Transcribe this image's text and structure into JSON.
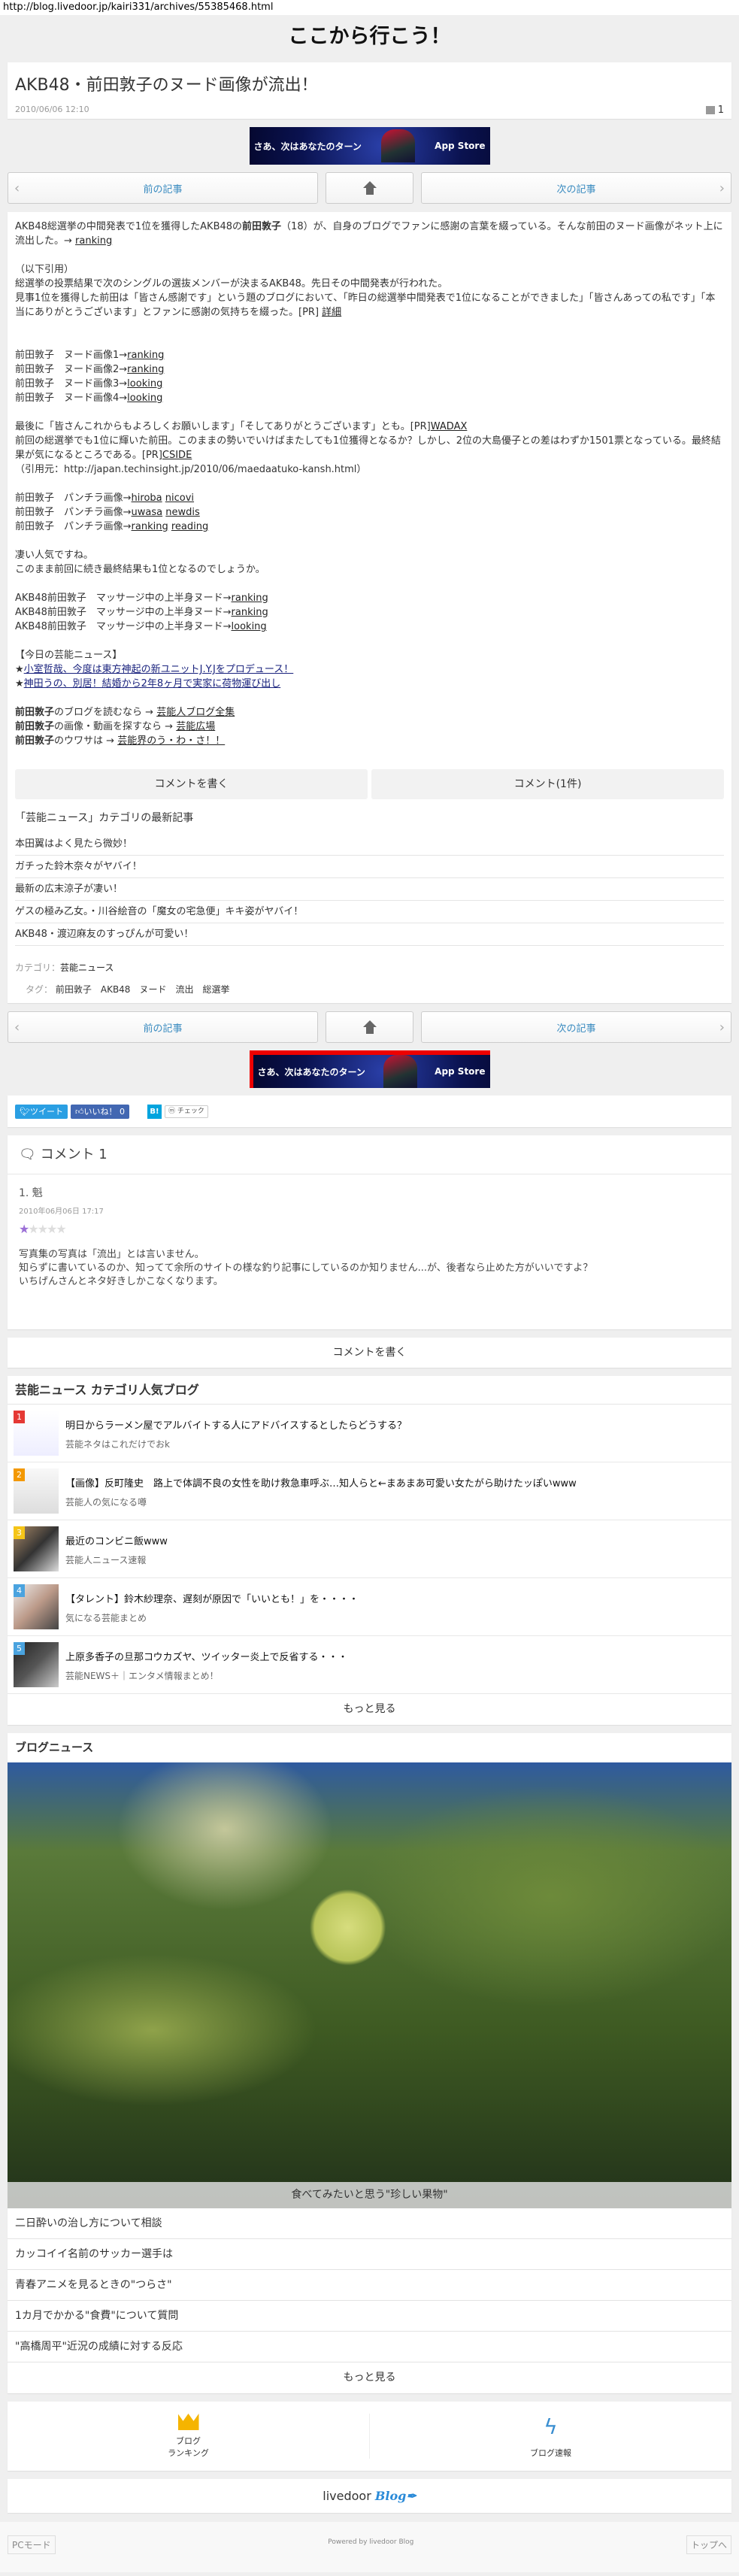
{
  "url": "http://blog.livedoor.jp/kairi331/archives/55385468.html",
  "site_title": "ここから行こう！",
  "article": {
    "title": "AKB48・前田敦子のヌード画像が流出！",
    "date": "2010/06/06 12:10",
    "comment_count": "1",
    "body": [
      [
        {
          "text": "AKB48総選挙の中間発表で1位を獲得したAKB48の"
        },
        {
          "text": "前田敦子",
          "style": "bold"
        },
        {
          "text": "（18）が、自身のブログでファンに感謝の言葉を綴っている。そんな前田のヌード画像がネット上に流出した。→ "
        },
        {
          "text": "ranking",
          "style": "link"
        }
      ],
      [],
      [
        {
          "text": "（以下引用）"
        }
      ],
      [
        {
          "text": "総選挙の投票結果で次のシングルの選抜メンバーが決まるAKB48。先日その中間発表が行われた。"
        }
      ],
      [
        {
          "text": "見事1位を獲得した前田は「皆さん感謝です」という題のブログにおいて、「昨日の総選挙中間発表で1位になることができました」「皆さんあっての私です」「本当にありがとうございます」とファンに感謝の気持ちを綴った。[PR] "
        },
        {
          "text": "詳細",
          "style": "link"
        }
      ],
      [],
      [],
      [
        {
          "text": "前田敦子　ヌード画像1→"
        },
        {
          "text": "ranking",
          "style": "link"
        }
      ],
      [
        {
          "text": "前田敦子　ヌード画像2→"
        },
        {
          "text": "ranking",
          "style": "link"
        }
      ],
      [
        {
          "text": "前田敦子　ヌード画像3→"
        },
        {
          "text": "looking",
          "style": "link"
        }
      ],
      [
        {
          "text": "前田敦子　ヌード画像4→"
        },
        {
          "text": "looking",
          "style": "link"
        }
      ],
      [],
      [
        {
          "text": "最後に「皆さんこれからもよろしくお願いします」「そしてありがとうございます」とも。[PR]"
        },
        {
          "text": "WADAX",
          "style": "link"
        }
      ],
      [
        {
          "text": "前回の総選挙でも1位に輝いた前田。このままの勢いでいけばまたしても1位獲得となるか？しかし、2位の大島優子との差はわずか1501票となっている。最終結果が気になるところである。[PR]"
        },
        {
          "text": "CSIDE",
          "style": "link"
        }
      ],
      [
        {
          "text": "（引用元：http://japan.techinsight.jp/2010/06/maedaatuko-kansh.html）"
        }
      ],
      [],
      [
        {
          "text": "前田敦子　パンチラ画像→"
        },
        {
          "text": "hiroba",
          "style": "link"
        },
        {
          "text": " "
        },
        {
          "text": "nicovi",
          "style": "link"
        }
      ],
      [
        {
          "text": "前田敦子　パンチラ画像→"
        },
        {
          "text": "uwasa",
          "style": "link"
        },
        {
          "text": " "
        },
        {
          "text": "newdis",
          "style": "link"
        }
      ],
      [
        {
          "text": "前田敦子　パンチラ画像→"
        },
        {
          "text": "ranking",
          "style": "link"
        },
        {
          "text": " "
        },
        {
          "text": "reading",
          "style": "link"
        }
      ],
      [],
      [
        {
          "text": "凄い人気ですね。"
        }
      ],
      [
        {
          "text": "このまま前回に続き最終結果も1位となるのでしょうか。"
        }
      ],
      [],
      [
        {
          "text": "AKB48前田敦子　マッサージ中の上半身ヌード→"
        },
        {
          "text": "ranking",
          "style": "link"
        }
      ],
      [
        {
          "text": "AKB48前田敦子　マッサージ中の上半身ヌード→"
        },
        {
          "text": "ranking",
          "style": "link"
        }
      ],
      [
        {
          "text": "AKB48前田敦子　マッサージ中の上半身ヌード→"
        },
        {
          "text": "looking",
          "style": "link"
        }
      ],
      [],
      [
        {
          "text": "【今日の芸能ニュース】"
        }
      ],
      [
        {
          "text": "★"
        },
        {
          "text": "小室哲哉、今度は東方神起の新ユニットJ.Y.Jをプロデュース！",
          "style": "news-link"
        }
      ],
      [
        {
          "text": "★"
        },
        {
          "text": "神田うの、別居！結婚から2年8ヶ月で実家に荷物運び出し",
          "style": "news-link"
        }
      ],
      [],
      [
        {
          "text": "前田敦子",
          "style": "bold"
        },
        {
          "text": "のブログを読むなら → "
        },
        {
          "text": "芸能人ブログ全集",
          "style": "link"
        }
      ],
      [
        {
          "text": "前田敦子",
          "style": "bold"
        },
        {
          "text": "の画像・動画を探すなら → "
        },
        {
          "text": "芸能広場",
          "style": "link"
        }
      ],
      [
        {
          "text": "前田敦子",
          "style": "bold"
        },
        {
          "text": "のウワサは → "
        },
        {
          "text": "芸能界のう・わ・さ！！",
          "style": "link"
        }
      ]
    ],
    "write_comment": "コメントを書く",
    "comments_btn": "コメント(1件)",
    "category_heading": "「芸能ニュース」カテゴリの最新記事",
    "recent": [
      "本田翼はよく見たら微妙！",
      "ガチった鈴木奈々がヤバイ！",
      "最新の広末涼子が凄い！",
      "ゲスの極み乙女。・川谷絵音の「魔女の宅急便」キキ姿がヤバイ！",
      "AKB48・渡辺麻友のすっぴんが可愛い！"
    ],
    "category_label": "カテゴリ：",
    "category": "芸能ニュース",
    "tags_label": "タグ：",
    "tags": [
      "前田敦子",
      "AKB48",
      "ヌード",
      "流出",
      "総選挙"
    ]
  },
  "nav": {
    "prev": "前の記事",
    "next": "次の記事"
  },
  "banner": {
    "text": "さあ、次はあなたのターン",
    "store": "App Store"
  },
  "share": {
    "tweet": "ツイート",
    "like": "いいね！ 0",
    "hatena": "B!",
    "mixi": "チェック"
  },
  "comments": {
    "heading": "コメント 1",
    "items": [
      {
        "name": "1. 魁",
        "date": "2010年06月06日 17:17",
        "rating": 1,
        "max": 5,
        "lines": [
          "写真集の写真は「流出」とは言いません。",
          "知らずに書いているのか、知ってて余所のサイトの様な釣り記事にしているのか知りません...が、後者なら止めた方がいいですよ？",
          "いちげんさんとネタ好きしかこなくなります。"
        ]
      }
    ]
  },
  "write_comment": "コメントを書く",
  "popular": {
    "heading": "芸能ニュース カテゴリ人気ブログ",
    "more": "もっと見る",
    "items": [
      {
        "rank": "1",
        "color": "#e53935",
        "title": "明日からラーメン屋でアルバイトする人にアドバイスするとしたらどうする？",
        "blog": "芸能ネタはこれだけでおk"
      },
      {
        "rank": "2",
        "color": "#f39800",
        "title": "【画像】反町隆史　路上で体調不良の女性を助け救急車呼ぶ…知人らと←まあまあ可愛い女たがら助けたッぽいwww",
        "blog": "芸能人の気になる噂"
      },
      {
        "rank": "3",
        "color": "#f5c518",
        "title": "最近のコンビニ飯www",
        "blog": "芸能人ニュース速報"
      },
      {
        "rank": "4",
        "color": "#4aa3df",
        "title": "【タレント】鈴木紗理奈、遅刻が原因で「いいとも！」を・・・・",
        "blog": "気になる芸能まとめ"
      },
      {
        "rank": "5",
        "color": "#4aa3df",
        "title": "上原多香子の旦那コウカズヤ、ツイッター炎上で反省する・・・",
        "blog": "芸能NEWS＋｜エンタメ情報まとめ！"
      }
    ]
  },
  "blog_news": {
    "heading": "ブログニュース",
    "feature": "食べてみたいと思う\"珍しい果物\"",
    "items": [
      "二日酔いの治し方について相談",
      "カッコイイ名前のサッカー選手は",
      "青春アニメを見るときの\"つらさ\"",
      "1カ月でかかる\"食費\"について質問",
      "\"高橋周平\"近況の成績に対する反応"
    ],
    "more": "もっと見る"
  },
  "links": {
    "ranking": "ブログ\nランキング",
    "ranking_l1": "ブログ",
    "ranking_l2": "ランキング",
    "sokuho": "ブログ速報"
  },
  "logo": {
    "word": "livedoor",
    "blog": "Blog"
  },
  "footer": {
    "pc": "PCモード",
    "powered": "Powered by livedoor Blog",
    "top": "トップへ"
  }
}
